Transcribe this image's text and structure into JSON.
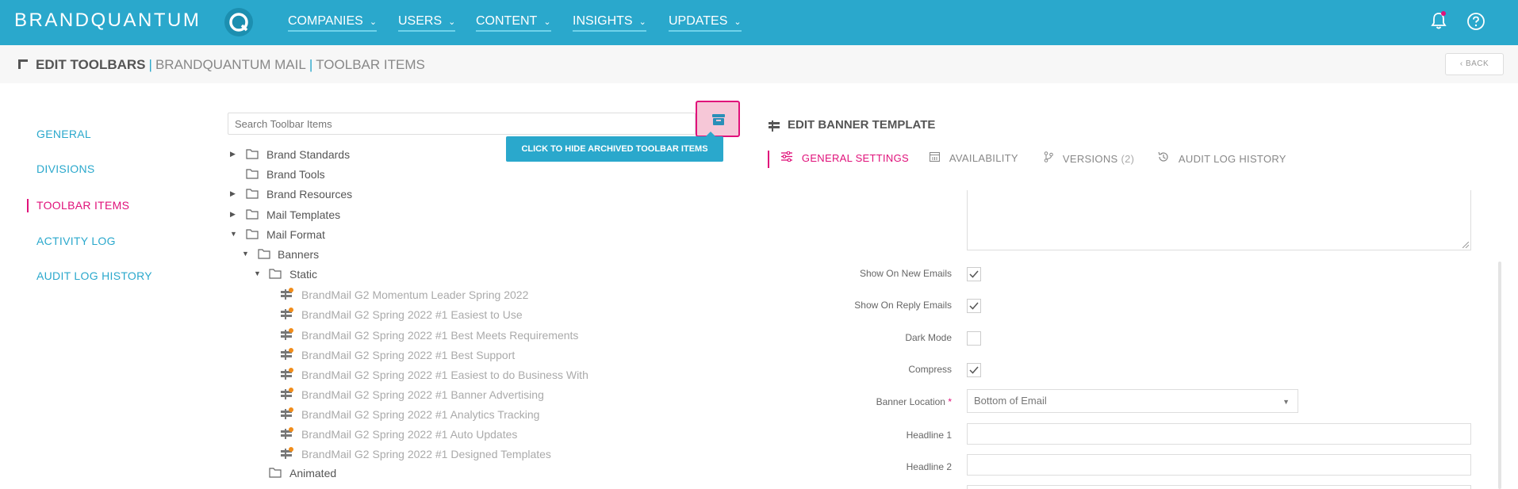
{
  "app": {
    "brand": "BRANDQUANTUM",
    "accent_color": "#2aa8cc",
    "highlight_color": "#e0117a"
  },
  "topnav": [
    {
      "label": "COMPANIES"
    },
    {
      "label": "USERS"
    },
    {
      "label": "CONTENT"
    },
    {
      "label": "INSIGHTS"
    },
    {
      "label": "UPDATES"
    }
  ],
  "breadcrumb": {
    "part1": "EDIT TOOLBARS",
    "part2": "BRANDQUANTUM MAIL",
    "part3": "TOOLBAR ITEMS",
    "separator": "|"
  },
  "back_label": "BACK",
  "leftnav": [
    {
      "label": "GENERAL"
    },
    {
      "label": "DIVISIONS"
    },
    {
      "label": "TOOLBAR ITEMS",
      "active": true
    },
    {
      "label": "ACTIVITY LOG"
    },
    {
      "label": "AUDIT LOG HISTORY"
    }
  ],
  "search": {
    "placeholder": "Search Toolbar Items"
  },
  "tooltip": "CLICK TO HIDE ARCHIVED TOOLBAR ITEMS",
  "tree": {
    "folders": [
      {
        "label": "Brand Standards",
        "state": "collapsed"
      },
      {
        "label": "Brand Tools",
        "state": "none"
      },
      {
        "label": "Brand Resources",
        "state": "collapsed"
      },
      {
        "label": "Mail Templates",
        "state": "collapsed"
      },
      {
        "label": "Mail Format",
        "state": "expanded"
      },
      {
        "label": "Banners",
        "state": "expanded"
      },
      {
        "label": "Static",
        "state": "expanded"
      },
      {
        "label": "Animated",
        "state": "none"
      }
    ],
    "items": [
      "BrandMail G2 Momentum Leader Spring 2022",
      "BrandMail G2 Spring 2022 #1 Easiest to Use",
      "BrandMail G2 Spring 2022 #1 Best Meets Requirements",
      "BrandMail G2 Spring 2022 #1 Best Support",
      "BrandMail G2 Spring 2022 #1 Easiest to do Business With",
      "BrandMail G2 Spring 2022 #1 Banner Advertising",
      "BrandMail G2 Spring 2022 #1 Analytics Tracking",
      "BrandMail G2 Spring 2022 #1 Auto Updates",
      "BrandMail G2 Spring 2022 #1 Designed Templates"
    ]
  },
  "panel": {
    "title": "EDIT BANNER TEMPLATE",
    "tabs": [
      {
        "label": "GENERAL SETTINGS",
        "active": true
      },
      {
        "label": "AVAILABILITY"
      },
      {
        "label": "VERSIONS",
        "count": "(2)"
      },
      {
        "label": "AUDIT LOG HISTORY"
      }
    ],
    "fields": {
      "show_on_new": {
        "label": "Show On New Emails",
        "checked": true
      },
      "show_on_reply": {
        "label": "Show On Reply Emails",
        "checked": true
      },
      "dark_mode": {
        "label": "Dark Mode",
        "checked": false
      },
      "compress": {
        "label": "Compress",
        "checked": true
      },
      "banner_location": {
        "label": "Banner Location",
        "required_mark": "*",
        "value": "Bottom of Email"
      },
      "headline1": {
        "label": "Headline 1",
        "value": ""
      },
      "headline2": {
        "label": "Headline 2",
        "value": ""
      }
    }
  }
}
